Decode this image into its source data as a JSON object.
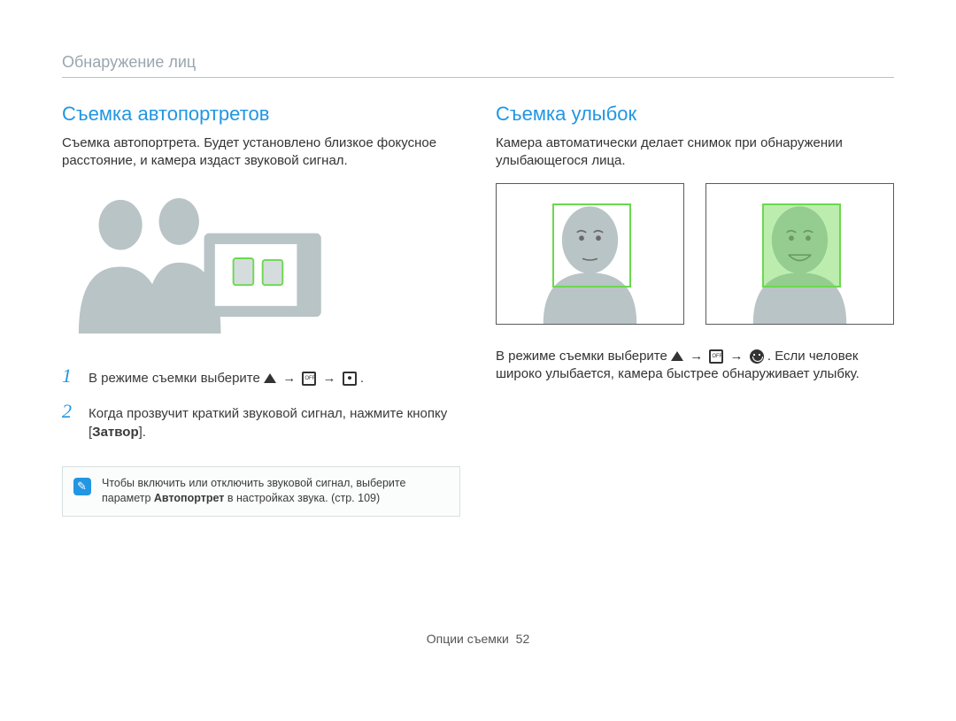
{
  "breadcrumb": "Обнаружение лиц",
  "left": {
    "title": "Съемка автопортретов",
    "intro": "Съемка автопортрета. Будет установлено близкое фокусное расстояние, и камера издаст звуковой сигнал.",
    "step1_pre": "В режиме съемки выберите ",
    "step1_post": ".",
    "step2_pre": "Когда прозвучит краткий звуковой сигнал, нажмите кнопку [",
    "step2_bold": "Затвор",
    "step2_post": "].",
    "note_pre": "Чтобы включить или отключить звуковой сигнал, выберите параметр ",
    "note_bold": "Автопортрет",
    "note_post": " в настройках звука. (стр. 109)"
  },
  "right": {
    "title": "Съемка улыбок",
    "intro": "Камера автоматически делает снимок при обнаружении улыбающегося лица.",
    "para_pre": "В режиме съемки выберите ",
    "para_mid": ". Если человек широко улыбается, камера быстрее обнаруживает улыбку."
  },
  "footer_label": "Опции съемки",
  "footer_page": "52"
}
